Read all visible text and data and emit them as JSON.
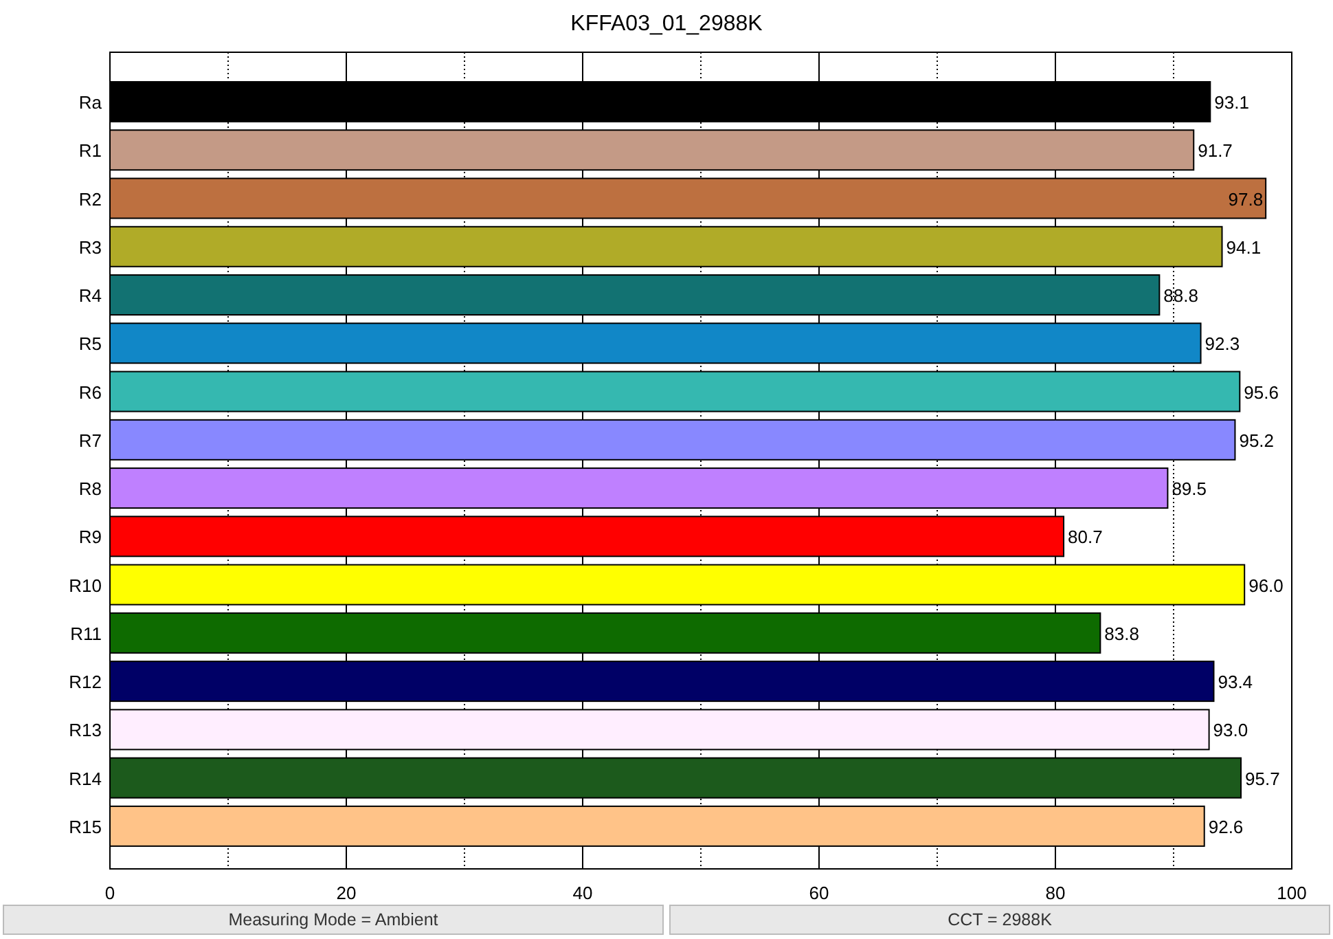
{
  "chart_data": {
    "type": "bar",
    "orientation": "horizontal",
    "title": "KFFA03_01_2988K",
    "grid": true,
    "xlim": [
      0,
      100
    ],
    "xticks": [
      0,
      20,
      40,
      60,
      80,
      100
    ],
    "series": [
      {
        "name": "Ra",
        "color": "#000000",
        "values": [
          93.1,
          null,
          null,
          null,
          null,
          null,
          null,
          null,
          null,
          null,
          null,
          null,
          null,
          null,
          null,
          null
        ],
        "value_labels": [
          "93.1",
          null,
          null,
          null,
          null,
          null,
          null,
          null,
          null,
          null,
          null,
          null,
          null,
          null,
          null,
          null
        ]
      },
      {
        "name": "R1",
        "color": "#c49a86",
        "values": [
          null,
          91.7,
          null,
          null,
          null,
          null,
          null,
          null,
          null,
          null,
          null,
          null,
          null,
          null,
          null,
          null
        ],
        "value_labels": [
          null,
          "91.7",
          null,
          null,
          null,
          null,
          null,
          null,
          null,
          null,
          null,
          null,
          null,
          null,
          null,
          null
        ]
      },
      {
        "name": "R2",
        "color": "#bd7040",
        "values": [
          null,
          null,
          97.8,
          null,
          null,
          null,
          null,
          null,
          null,
          null,
          null,
          null,
          null,
          null,
          null,
          null
        ],
        "value_labels": [
          null,
          null,
          "97.8",
          null,
          null,
          null,
          null,
          null,
          null,
          null,
          null,
          null,
          null,
          null,
          null,
          null
        ]
      },
      {
        "name": "R3",
        "color": "#b0ab28",
        "values": [
          null,
          null,
          null,
          94.1,
          null,
          null,
          null,
          null,
          null,
          null,
          null,
          null,
          null,
          null,
          null,
          null
        ],
        "value_labels": [
          null,
          null,
          null,
          "94.1",
          null,
          null,
          null,
          null,
          null,
          null,
          null,
          null,
          null,
          null,
          null,
          null
        ]
      },
      {
        "name": "R4",
        "color": "#127272",
        "values": [
          null,
          null,
          null,
          null,
          88.8,
          null,
          null,
          null,
          null,
          null,
          null,
          null,
          null,
          null,
          null,
          null
        ],
        "value_labels": [
          null,
          null,
          null,
          null,
          "88.8",
          null,
          null,
          null,
          null,
          null,
          null,
          null,
          null,
          null,
          null,
          null
        ]
      },
      {
        "name": "R5",
        "color": "#1187c7",
        "values": [
          null,
          null,
          null,
          null,
          null,
          92.3,
          null,
          null,
          null,
          null,
          null,
          null,
          null,
          null,
          null,
          null
        ],
        "value_labels": [
          null,
          null,
          null,
          null,
          null,
          "92.3",
          null,
          null,
          null,
          null,
          null,
          null,
          null,
          null,
          null,
          null
        ]
      },
      {
        "name": "R6",
        "color": "#35b8b0",
        "values": [
          null,
          null,
          null,
          null,
          null,
          null,
          95.6,
          null,
          null,
          null,
          null,
          null,
          null,
          null,
          null,
          null
        ],
        "value_labels": [
          null,
          null,
          null,
          null,
          null,
          null,
          "95.6",
          null,
          null,
          null,
          null,
          null,
          null,
          null,
          null,
          null
        ]
      },
      {
        "name": "R7",
        "color": "#8888ff",
        "values": [
          null,
          null,
          null,
          null,
          null,
          null,
          null,
          95.2,
          null,
          null,
          null,
          null,
          null,
          null,
          null,
          null
        ],
        "value_labels": [
          null,
          null,
          null,
          null,
          null,
          null,
          null,
          "95.2",
          null,
          null,
          null,
          null,
          null,
          null,
          null,
          null
        ]
      },
      {
        "name": "R8",
        "color": "#bf80ff",
        "values": [
          null,
          null,
          null,
          null,
          null,
          null,
          null,
          null,
          89.5,
          null,
          null,
          null,
          null,
          null,
          null,
          null
        ],
        "value_labels": [
          null,
          null,
          null,
          null,
          null,
          null,
          null,
          null,
          "89.5",
          null,
          null,
          null,
          null,
          null,
          null,
          null
        ]
      },
      {
        "name": "R9",
        "color": "#ff0000",
        "values": [
          null,
          null,
          null,
          null,
          null,
          null,
          null,
          null,
          null,
          80.7,
          null,
          null,
          null,
          null,
          null,
          null
        ],
        "value_labels": [
          null,
          null,
          null,
          null,
          null,
          null,
          null,
          null,
          null,
          "80.7",
          null,
          null,
          null,
          null,
          null,
          null
        ]
      },
      {
        "name": "R10",
        "color": "#ffff00",
        "values": [
          null,
          null,
          null,
          null,
          null,
          null,
          null,
          null,
          null,
          null,
          96.0,
          null,
          null,
          null,
          null,
          null
        ],
        "value_labels": [
          null,
          null,
          null,
          null,
          null,
          null,
          null,
          null,
          null,
          null,
          "96.0",
          null,
          null,
          null,
          null,
          null
        ]
      },
      {
        "name": "R11",
        "color": "#0e6b00",
        "values": [
          null,
          null,
          null,
          null,
          null,
          null,
          null,
          null,
          null,
          null,
          null,
          83.8,
          null,
          null,
          null,
          null
        ],
        "value_labels": [
          null,
          null,
          null,
          null,
          null,
          null,
          null,
          null,
          null,
          null,
          null,
          "83.8",
          null,
          null,
          null,
          null
        ]
      },
      {
        "name": "R12",
        "color": "#000066",
        "values": [
          null,
          null,
          null,
          null,
          null,
          null,
          null,
          null,
          null,
          null,
          null,
          null,
          93.4,
          null,
          null,
          null
        ],
        "value_labels": [
          null,
          null,
          null,
          null,
          null,
          null,
          null,
          null,
          null,
          null,
          null,
          null,
          "93.4",
          null,
          null,
          null
        ]
      },
      {
        "name": "R13",
        "color": "#ffeeff",
        "values": [
          null,
          null,
          null,
          null,
          null,
          null,
          null,
          null,
          null,
          null,
          null,
          null,
          null,
          93.0,
          null,
          null
        ],
        "value_labels": [
          null,
          null,
          null,
          null,
          null,
          null,
          null,
          null,
          null,
          null,
          null,
          null,
          null,
          "93.0",
          null,
          null
        ]
      },
      {
        "name": "R14",
        "color": "#1c5a1c",
        "values": [
          null,
          null,
          null,
          null,
          null,
          null,
          null,
          null,
          null,
          null,
          null,
          null,
          null,
          null,
          95.7,
          null
        ],
        "value_labels": [
          null,
          null,
          null,
          null,
          null,
          null,
          null,
          null,
          null,
          null,
          null,
          null,
          null,
          null,
          "95.7",
          null
        ]
      },
      {
        "name": "R15",
        "color": "#ffc388",
        "values": [
          null,
          null,
          null,
          null,
          null,
          null,
          null,
          null,
          null,
          null,
          null,
          null,
          null,
          null,
          null,
          92.6
        ],
        "value_labels": [
          null,
          null,
          null,
          null,
          null,
          null,
          null,
          null,
          null,
          null,
          null,
          null,
          null,
          null,
          null,
          "92.6"
        ]
      }
    ]
  },
  "status_bar": [
    {
      "text": "Measuring Mode = Ambient"
    },
    {
      "text": "CCT = 2988K"
    }
  ]
}
